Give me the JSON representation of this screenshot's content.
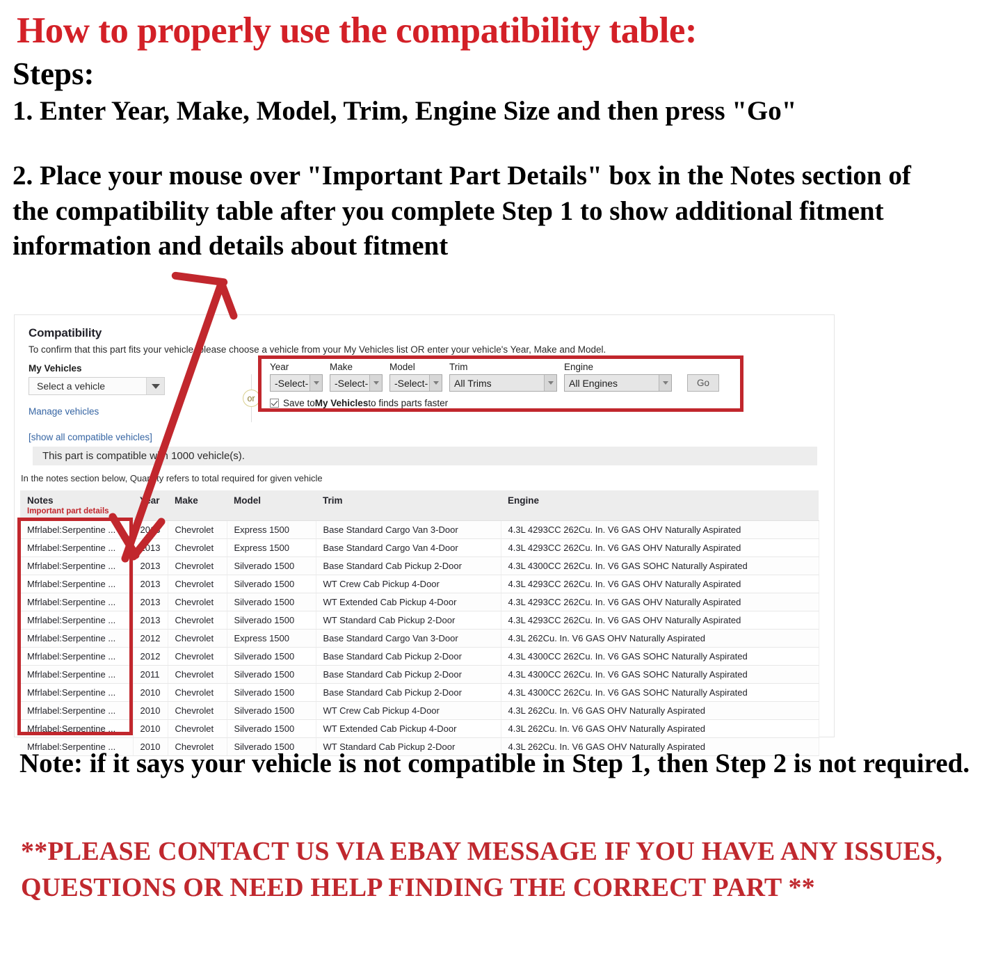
{
  "header": {
    "title": "How to properly use the compatibility table:",
    "steps_label": "Steps:",
    "step1": "1. Enter Year, Make, Model, Trim, Engine Size and then press \"Go\"",
    "step2": "2. Place your mouse over \"Important Part Details\" box in the Notes section of the compatibility table after you complete Step 1 to show additional fitment information and details about fitment"
  },
  "compatibility": {
    "title": "Compatibility",
    "subtitle": "To confirm that this part fits your vehicle, please choose a vehicle from your My Vehicles list OR enter your vehicle's Year, Make and Model.",
    "my_vehicles_label": "My Vehicles",
    "my_vehicles_value": "Select a vehicle",
    "manage_vehicles_link": "Manage vehicles",
    "show_all_link": "[show all compatible vehicles]",
    "or_label": "or",
    "banner": "This part is compatible with 1000 vehicle(s).",
    "notes_hint": "In the notes section below, Quantity refers to total required for given vehicle",
    "form": {
      "year_label": "Year",
      "year_value": "-Select-",
      "make_label": "Make",
      "make_value": "-Select-",
      "model_label": "Model",
      "model_value": "-Select-",
      "trim_label": "Trim",
      "trim_value": "All Trims",
      "engine_label": "Engine",
      "engine_value": "All Engines",
      "go_label": "Go",
      "save_prefix": "Save to ",
      "save_bold": "My Vehicles",
      "save_suffix": " to finds parts faster"
    },
    "table": {
      "headers": [
        "Notes",
        "Year",
        "Make",
        "Model",
        "Trim",
        "Engine"
      ],
      "notes_sub": "Important part details",
      "rows": [
        {
          "notes": "Mfrlabel:Serpentine ...",
          "year": "2013",
          "make": "Chevrolet",
          "model": "Express 1500",
          "trim": "Base Standard Cargo Van 3-Door",
          "engine": "4.3L 4293CC 262Cu. In. V6 GAS OHV Naturally Aspirated"
        },
        {
          "notes": "Mfrlabel:Serpentine ...",
          "year": "2013",
          "make": "Chevrolet",
          "model": "Express 1500",
          "trim": "Base Standard Cargo Van 4-Door",
          "engine": "4.3L 4293CC 262Cu. In. V6 GAS OHV Naturally Aspirated"
        },
        {
          "notes": "Mfrlabel:Serpentine ...",
          "year": "2013",
          "make": "Chevrolet",
          "model": "Silverado 1500",
          "trim": "Base Standard Cab Pickup 2-Door",
          "engine": "4.3L 4300CC 262Cu. In. V6 GAS SOHC Naturally Aspirated"
        },
        {
          "notes": "Mfrlabel:Serpentine ...",
          "year": "2013",
          "make": "Chevrolet",
          "model": "Silverado 1500",
          "trim": "WT Crew Cab Pickup 4-Door",
          "engine": "4.3L 4293CC 262Cu. In. V6 GAS OHV Naturally Aspirated"
        },
        {
          "notes": "Mfrlabel:Serpentine ...",
          "year": "2013",
          "make": "Chevrolet",
          "model": "Silverado 1500",
          "trim": "WT Extended Cab Pickup 4-Door",
          "engine": "4.3L 4293CC 262Cu. In. V6 GAS OHV Naturally Aspirated"
        },
        {
          "notes": "Mfrlabel:Serpentine ...",
          "year": "2013",
          "make": "Chevrolet",
          "model": "Silverado 1500",
          "trim": "WT Standard Cab Pickup 2-Door",
          "engine": "4.3L 4293CC 262Cu. In. V6 GAS OHV Naturally Aspirated"
        },
        {
          "notes": "Mfrlabel:Serpentine ...",
          "year": "2012",
          "make": "Chevrolet",
          "model": "Express 1500",
          "trim": "Base Standard Cargo Van 3-Door",
          "engine": "4.3L 262Cu. In. V6 GAS OHV Naturally Aspirated"
        },
        {
          "notes": "Mfrlabel:Serpentine ...",
          "year": "2012",
          "make": "Chevrolet",
          "model": "Silverado 1500",
          "trim": "Base Standard Cab Pickup 2-Door",
          "engine": "4.3L 4300CC 262Cu. In. V6 GAS SOHC Naturally Aspirated"
        },
        {
          "notes": "Mfrlabel:Serpentine ...",
          "year": "2011",
          "make": "Chevrolet",
          "model": "Silverado 1500",
          "trim": "Base Standard Cab Pickup 2-Door",
          "engine": "4.3L 4300CC 262Cu. In. V6 GAS SOHC Naturally Aspirated"
        },
        {
          "notes": "Mfrlabel:Serpentine ...",
          "year": "2010",
          "make": "Chevrolet",
          "model": "Silverado 1500",
          "trim": "Base Standard Cab Pickup 2-Door",
          "engine": "4.3L 4300CC 262Cu. In. V6 GAS SOHC Naturally Aspirated"
        },
        {
          "notes": "Mfrlabel:Serpentine ...",
          "year": "2010",
          "make": "Chevrolet",
          "model": "Silverado 1500",
          "trim": "WT Crew Cab Pickup 4-Door",
          "engine": "4.3L 262Cu. In. V6 GAS OHV Naturally Aspirated"
        },
        {
          "notes": "Mfrlabel:Serpentine ...",
          "year": "2010",
          "make": "Chevrolet",
          "model": "Silverado 1500",
          "trim": "WT Extended Cab Pickup 4-Door",
          "engine": "4.3L 262Cu. In. V6 GAS OHV Naturally Aspirated"
        },
        {
          "notes": "Mfrlabel:Serpentine ...",
          "year": "2010",
          "make": "Chevrolet",
          "model": "Silverado 1500",
          "trim": "WT Standard Cab Pickup 2-Door",
          "engine": "4.3L 262Cu. In. V6 GAS OHV Naturally Aspirated"
        }
      ]
    }
  },
  "footer": {
    "note": "Note: if it says your vehicle is not compatible in Step 1, then Step 2 is not required.",
    "contact": "**PLEASE CONTACT US VIA EBAY MESSAGE IF YOU HAVE ANY ISSUES, QUESTIONS OR NEED HELP FINDING THE CORRECT PART **"
  },
  "colors": {
    "headline_red": "#d32027",
    "highlight_red": "#c1272d",
    "link_blue": "#3665a3"
  }
}
